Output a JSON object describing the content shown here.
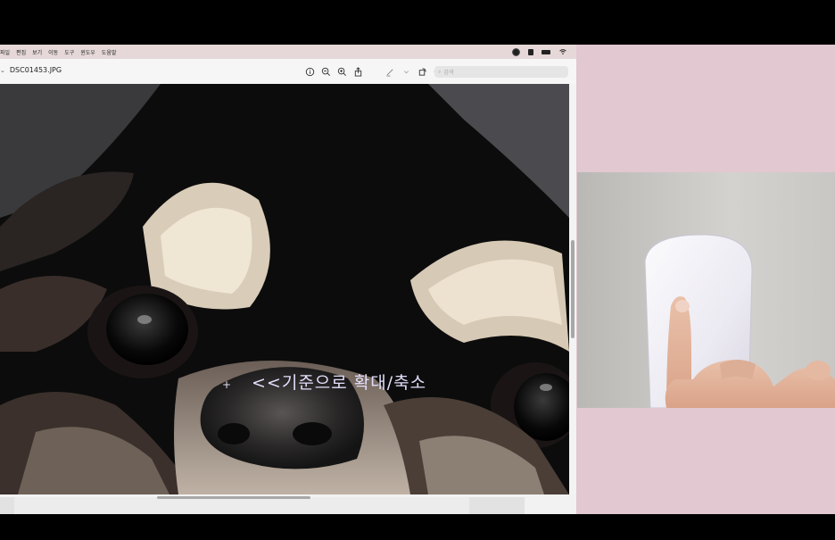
{
  "menubar": {
    "items": [
      "파일",
      "편집",
      "보기",
      "이동",
      "도구",
      "윈도우",
      "도움말"
    ]
  },
  "window": {
    "title": "DSC01453.JPG",
    "search_placeholder": "검색"
  },
  "overlay": {
    "caption": "<<기준으로 확대/축소"
  },
  "colors": {
    "menubar_bg": "#e6d8d8",
    "side_panel_bg": "#e2c8d0",
    "caption_color": "#e3defa"
  }
}
